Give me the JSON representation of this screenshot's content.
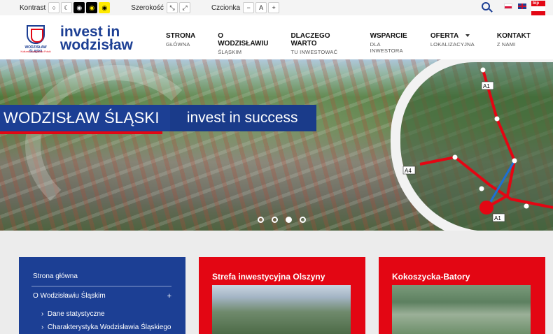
{
  "toolbar": {
    "contrast_label": "Kontrast",
    "width_label": "Szerokość",
    "font_label": "Czcionka",
    "font_a": "A"
  },
  "header": {
    "logo_line1": "WODZISŁAW ŚLĄSKI",
    "logo_line2": "Kulturalna wizytówka Polski",
    "brand_line1": "invest in",
    "brand_line2": "wodzisław"
  },
  "nav": [
    {
      "main": "STRONA",
      "sub": "GŁÓWNA"
    },
    {
      "main": "O WODZISŁAWIU",
      "sub": "ŚLĄSKIM"
    },
    {
      "main": "DLACZEGO WARTO",
      "sub": "TU INWESTOWAĆ"
    },
    {
      "main": "WSPARCIE",
      "sub": "DLA INWESTORA"
    },
    {
      "main": "OFERTA",
      "sub": "LOKALIZACYJNA"
    },
    {
      "main": "KONTAKT",
      "sub": "Z NAMI"
    }
  ],
  "hero": {
    "city": "WODZISŁAW ŚLĄSKI",
    "slogan": "invest in success",
    "road_a1_top": "A1",
    "road_a4": "A4",
    "road_a1_bottom": "A1",
    "slides_total": 4,
    "slide_active": 3
  },
  "sidebar": {
    "items": [
      "Strona główna",
      "O Wodzisławiu Śląskim",
      "Dane statystyczne",
      "Charakterystyka Wodzisławia Śląskiego"
    ],
    "expand_symbol": "+"
  },
  "cards": [
    {
      "title": "Strefa inwestycyjna Olszyny"
    },
    {
      "title": "Kokoszycka-Batory"
    }
  ],
  "bip_label": "bip",
  "colors": {
    "brand_blue": "#1c3f94",
    "brand_red": "#e30613"
  }
}
